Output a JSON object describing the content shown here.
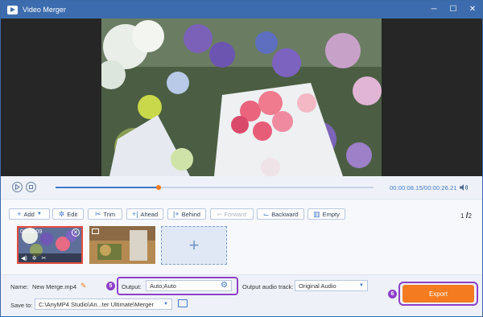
{
  "window": {
    "title": "Video Merger",
    "minimize_glyph": "─",
    "maximize_glyph": "☐",
    "close_glyph": "✕"
  },
  "player": {
    "current_time": "00:00:08.15",
    "total_time": "00:00:26.21",
    "progress": 0.323
  },
  "toolbar": {
    "add_label": "Add",
    "edit_label": "Edit",
    "trim_label": "Trim",
    "ahead_label": "Ahead",
    "behind_label": "Behind",
    "forward_label": "Forward",
    "backward_label": "Backward",
    "empty_label": "Empty"
  },
  "pager": {
    "current": "1",
    "separator": "/",
    "total": "2"
  },
  "clips": [
    {
      "duration": "00:00:09",
      "selected": true
    },
    {
      "duration": "",
      "selected": false
    }
  ],
  "add_clip_glyph": "+",
  "bottom": {
    "name_label": "Name:",
    "name_value": "New Merge.mp4",
    "output_label": "Output:",
    "output_value": "Auto;Auto",
    "audio_label": "Output audio track:",
    "audio_value": "Original Audio",
    "save_label": "Save to:",
    "save_path": "C:\\AnyMP4 Studio\\An...ter Ultimate\\Merger",
    "export_label": "Export"
  },
  "callouts": {
    "output_step": "5",
    "export_step": "6"
  },
  "colors": {
    "titlebar": "#3c6cad",
    "accent": "#3f79c6",
    "export": "#f47b20",
    "highlight": "#8e3fc9",
    "selected_clip": "#e24d3e"
  }
}
